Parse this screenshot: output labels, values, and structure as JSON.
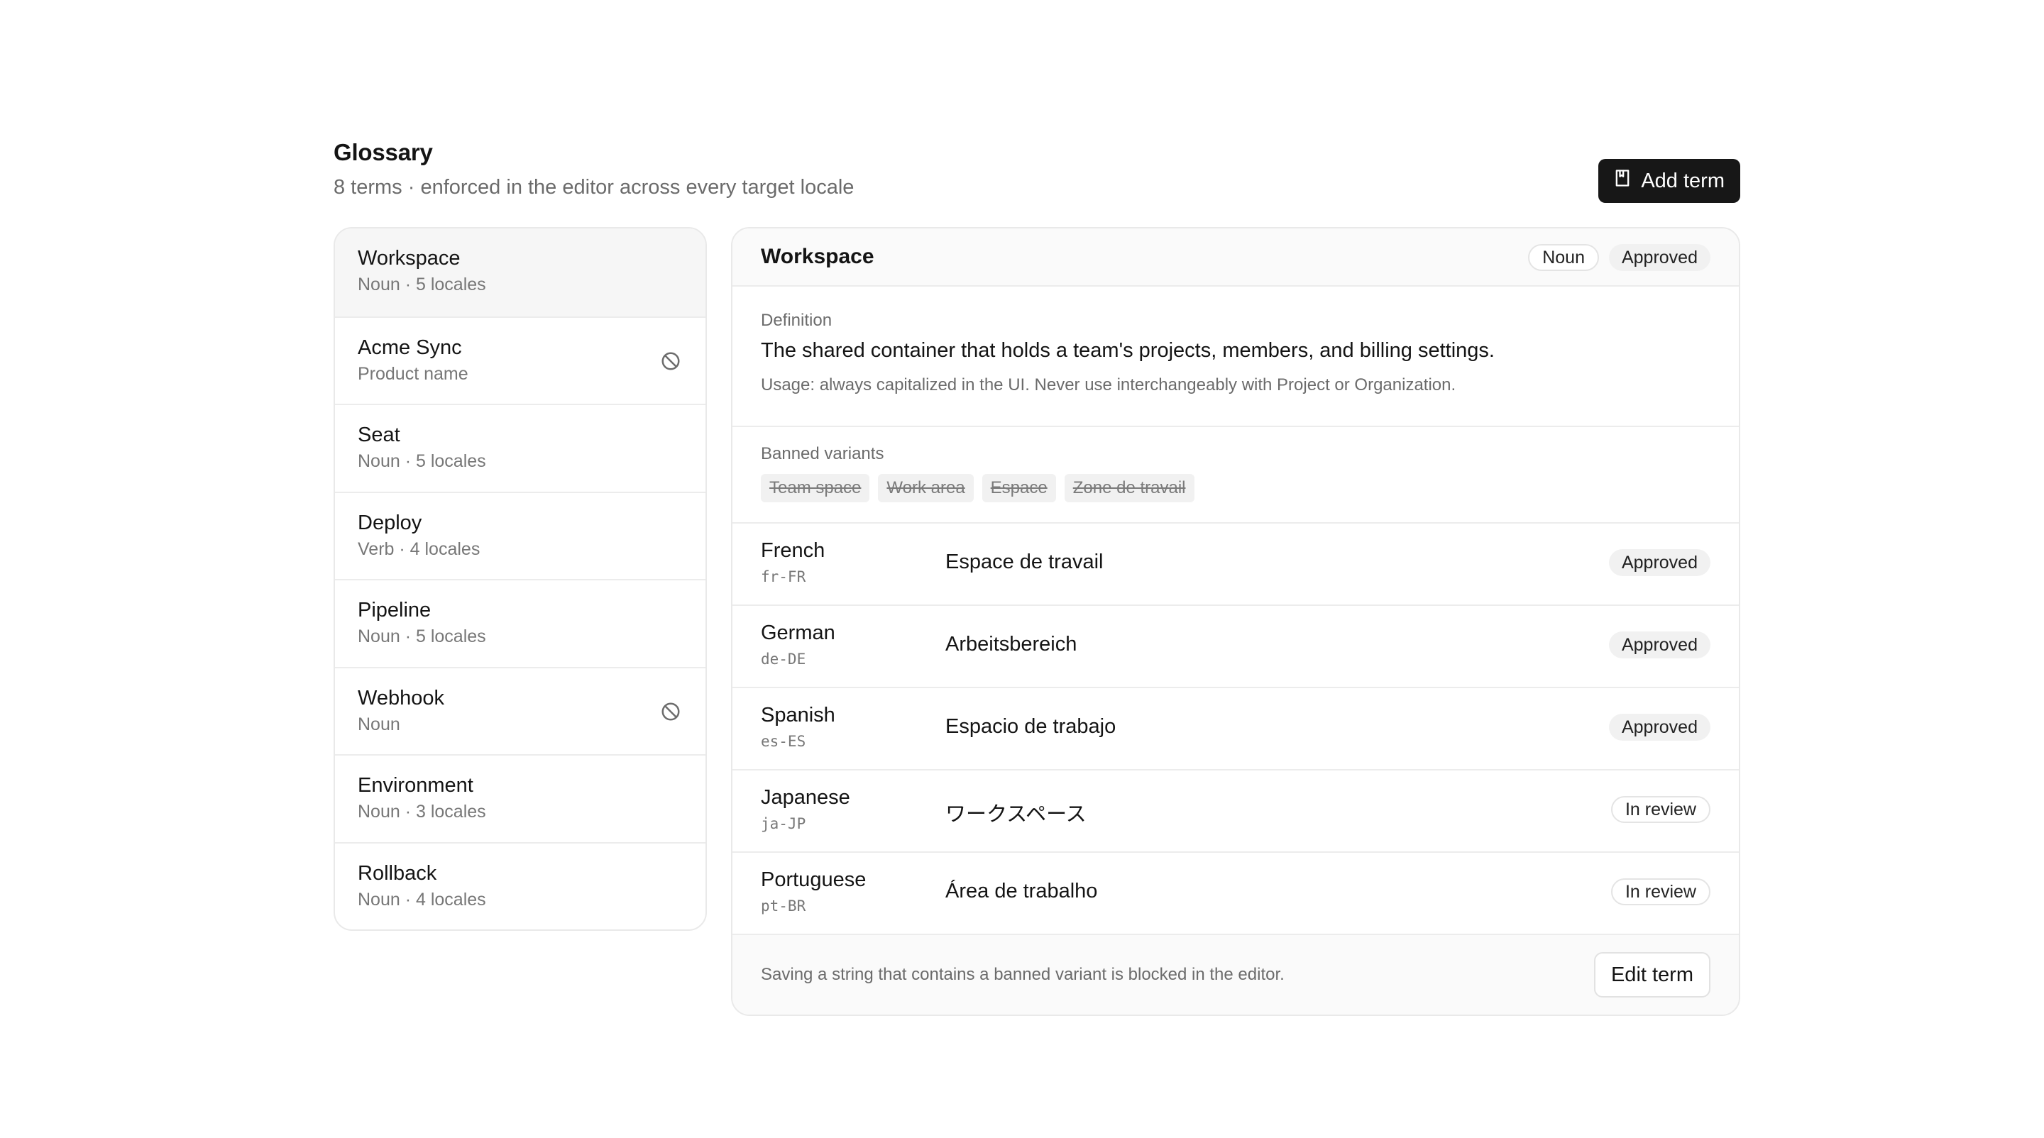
{
  "header": {
    "title": "Glossary",
    "subtitle": "8 terms · enforced in the editor across every target locale",
    "add_label": "Add term"
  },
  "terms": [
    {
      "name": "Workspace",
      "meta": "Noun · 5 locales",
      "banned_icon": false
    },
    {
      "name": "Acme Sync",
      "meta": "Product name",
      "banned_icon": true
    },
    {
      "name": "Seat",
      "meta": "Noun · 5 locales",
      "banned_icon": false
    },
    {
      "name": "Deploy",
      "meta": "Verb · 4 locales",
      "banned_icon": false
    },
    {
      "name": "Pipeline",
      "meta": "Noun · 5 locales",
      "banned_icon": false
    },
    {
      "name": "Webhook",
      "meta": "Noun",
      "banned_icon": true
    },
    {
      "name": "Environment",
      "meta": "Noun · 3 locales",
      "banned_icon": false
    },
    {
      "name": "Rollback",
      "meta": "Noun · 4 locales",
      "banned_icon": false
    }
  ],
  "detail": {
    "title": "Workspace",
    "part_of_speech": "Noun",
    "status": "Approved",
    "definition_label": "Definition",
    "definition": "The shared container that holds a team's projects, members, and billing settings.",
    "usage": "Usage: always capitalized in the UI. Never use interchangeably with Project or Organization.",
    "banned_label": "Banned variants",
    "banned": [
      "Team space",
      "Work area",
      "Espace",
      "Zone de travail"
    ],
    "locales": [
      {
        "language": "French",
        "code": "fr-FR",
        "translation": "Espace de travail",
        "status": "Approved"
      },
      {
        "language": "German",
        "code": "de-DE",
        "translation": "Arbeitsbereich",
        "status": "Approved"
      },
      {
        "language": "Spanish",
        "code": "es-ES",
        "translation": "Espacio de trabajo",
        "status": "Approved"
      },
      {
        "language": "Japanese",
        "code": "ja-JP",
        "translation": "ワークスペース",
        "status": "In review"
      },
      {
        "language": "Portuguese",
        "code": "pt-BR",
        "translation": "Área de trabalho",
        "status": "In review"
      }
    ],
    "footer_note": "Saving a string that contains a banned variant is blocked in the editor.",
    "edit_label": "Edit term"
  },
  "icons": {
    "add": "book-plus-icon",
    "banned": "ban-icon"
  }
}
